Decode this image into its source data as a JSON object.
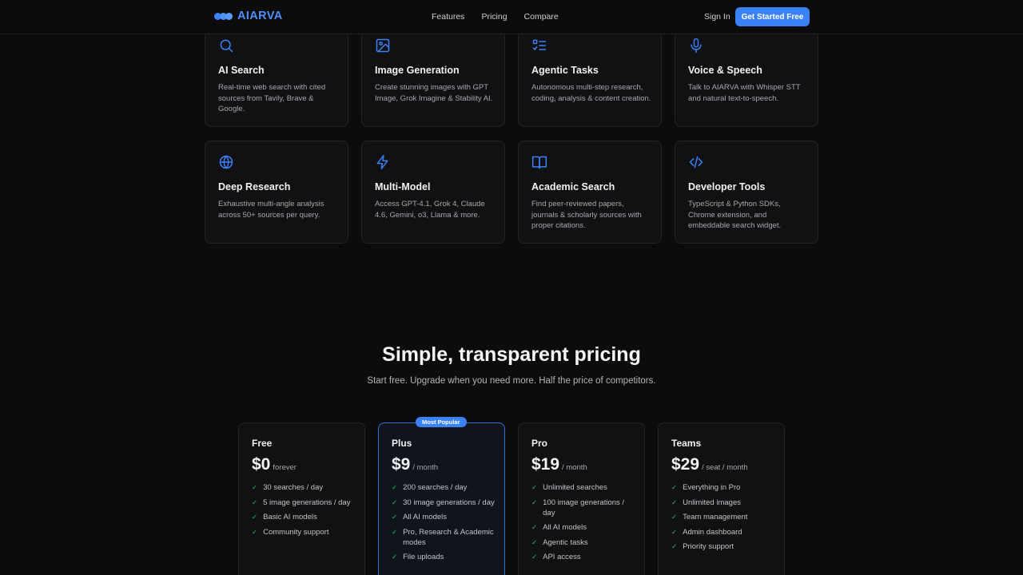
{
  "brand": {
    "name": "AIARVA",
    "accent": "#3b82f6",
    "check_color": "#22c55e"
  },
  "nav": {
    "links": [
      "Features",
      "Pricing",
      "Compare"
    ],
    "sign_in": "Sign In",
    "cta": "Get Started Free"
  },
  "features": [
    {
      "icon": "search-icon",
      "title": "AI Search",
      "description": "Real-time web search with cited sources from Tavily, Brave & Google."
    },
    {
      "icon": "image-icon",
      "title": "Image Generation",
      "description": "Create stunning images with GPT Image, Grok Imagine & Stability AI."
    },
    {
      "icon": "task-list-icon",
      "title": "Agentic Tasks",
      "description": "Autonomous multi-step research, coding, analysis & content creation."
    },
    {
      "icon": "microphone-icon",
      "title": "Voice & Speech",
      "description": "Talk to AIARVA with Whisper STT and natural text-to-speech."
    },
    {
      "icon": "globe-icon",
      "title": "Deep Research",
      "description": "Exhaustive multi-angle analysis across 50+ sources per query."
    },
    {
      "icon": "lightning-icon",
      "title": "Multi-Model",
      "description": "Access GPT-4.1, Grok 4, Claude 4.6, Gemini, o3, Llama & more."
    },
    {
      "icon": "book-icon",
      "title": "Academic Search",
      "description": "Find peer-reviewed papers, journals & scholarly sources with proper citations."
    },
    {
      "icon": "code-icon",
      "title": "Developer Tools",
      "description": "TypeScript & Python SDKs, Chrome extension, and embeddable search widget."
    }
  ],
  "pricing": {
    "title": "Simple, transparent pricing",
    "subtitle": "Start free. Upgrade when you need more. Half the price of competitors.",
    "plans": [
      {
        "name": "Free",
        "price": "$0",
        "period": "forever",
        "badge": "",
        "features": [
          "30 searches / day",
          "5 image generations / day",
          "Basic AI models",
          "Community support"
        ]
      },
      {
        "name": "Plus",
        "price": "$9",
        "period": "/ month",
        "badge": "Most Popular",
        "features": [
          "200 searches / day",
          "30 image generations / day",
          "All AI models",
          "Pro, Research & Academic modes",
          "File uploads"
        ]
      },
      {
        "name": "Pro",
        "price": "$19",
        "period": "/ month",
        "badge": "",
        "features": [
          "Unlimited searches",
          "100 image generations / day",
          "All AI models",
          "Agentic tasks",
          "API access"
        ]
      },
      {
        "name": "Teams",
        "price": "$29",
        "period": "/ seat / month",
        "badge": "",
        "features": [
          "Everything in Pro",
          "Unlimited images",
          "Team management",
          "Admin dashboard",
          "Priority support"
        ]
      }
    ]
  }
}
